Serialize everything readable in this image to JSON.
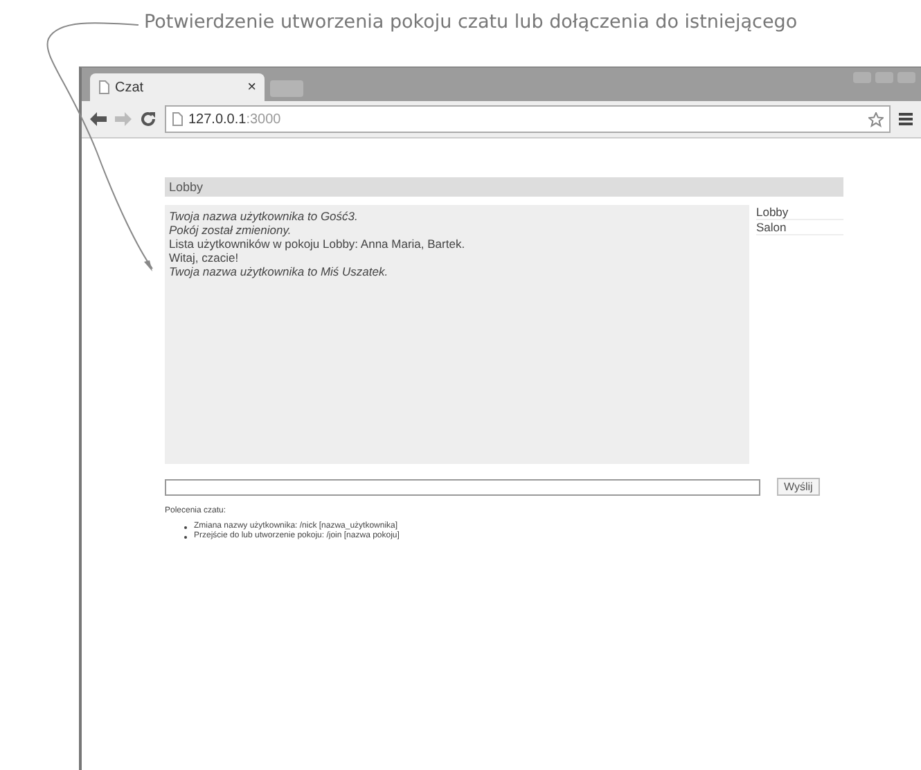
{
  "annotation": "Potwierdzenie utworzenia pokoju czatu lub dołączenia do istniejącego",
  "browser": {
    "tab_title": "Czat",
    "tab_close": "×",
    "url_host": "127.0.0.1",
    "url_port": ":3000"
  },
  "room_header": "Lobby",
  "messages": [
    {
      "kind": "system",
      "text": "Twoja nazwa użytkownika to Gość3."
    },
    {
      "kind": "system",
      "text": "Pokój został zmieniony."
    },
    {
      "kind": "message",
      "text": "Lista użytkowników w pokoju Lobby: Anna Maria, Bartek."
    },
    {
      "kind": "message",
      "text": "Witaj, czacie!"
    },
    {
      "kind": "system",
      "text": "Twoja nazwa użytkownika to Miś Uszatek."
    }
  ],
  "rooms": [
    "Lobby",
    "Salon"
  ],
  "send_button": "Wyślij",
  "help_title": "Polecenia czatu:",
  "commands": [
    "Zmiana nazwy użytkownika: /nick [nazwa_użytkownika]",
    "Przejście do lub utworzenie pokoju: /join [nazwa pokoju]"
  ]
}
